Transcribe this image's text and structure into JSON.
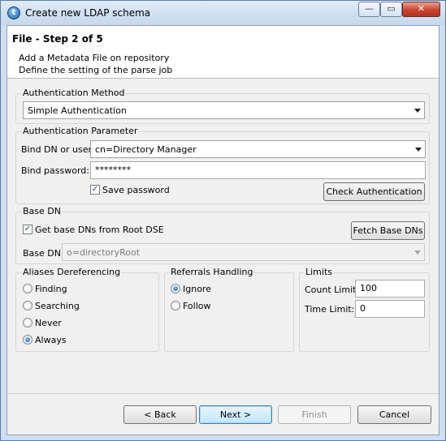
{
  "window": {
    "title": "Create new LDAP schema",
    "app_icon_letter": "t",
    "min_glyph": "—",
    "max_glyph": "▭",
    "close_glyph": "✕"
  },
  "header": {
    "title": "File - Step 2 of 5",
    "line1": "Add a Metadata File on repository",
    "line2": "Define the setting of the parse job"
  },
  "auth_method": {
    "group_label": "Authentication Method",
    "selected": "Simple Authentication"
  },
  "auth_param": {
    "group_label": "Authentication Parameter",
    "bind_dn_label": "Bind DN or user:",
    "bind_dn_value": "cn=Directory Manager",
    "bind_password_label": "Bind password:",
    "bind_password_value": "********",
    "save_password_label": "Save password",
    "save_password_checked": true,
    "check_button": "Check Authentication"
  },
  "base_dn": {
    "group_label": "Base DN",
    "get_from_root_label": "Get base DNs from Root DSE",
    "get_from_root_checked": true,
    "fetch_button": "Fetch Base DNs",
    "base_dn_label": "Base DN:",
    "base_dn_value": "o=directoryRoot"
  },
  "aliases": {
    "group_label": "Aliases Dereferencing",
    "options": [
      "Finding",
      "Searching",
      "Never",
      "Always"
    ],
    "selected": "Always"
  },
  "referrals": {
    "group_label": "Referrals Handling",
    "options": [
      "Ignore",
      "Follow"
    ],
    "selected": "Ignore"
  },
  "limits": {
    "group_label": "Limits",
    "count_label": "Count Limit:",
    "count_value": "100",
    "time_label": "Time Limit:",
    "time_value": "0"
  },
  "buttons": {
    "back": "< Back",
    "next": "Next >",
    "finish": "Finish",
    "cancel": "Cancel"
  }
}
